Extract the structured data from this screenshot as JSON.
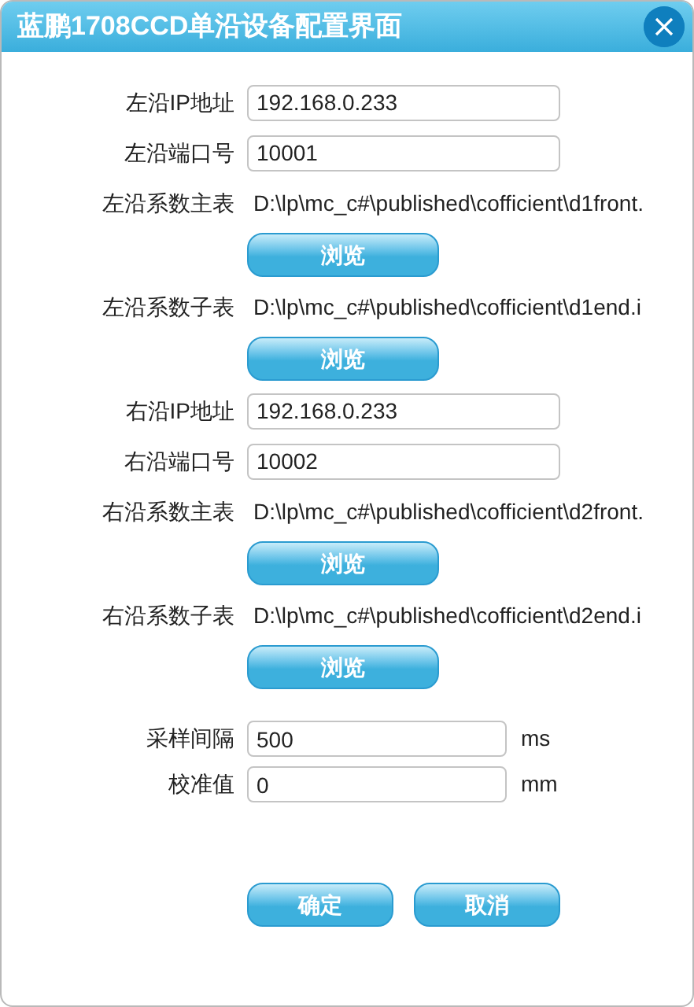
{
  "window": {
    "title": "蓝鹏1708CCD单沿设备配置界面"
  },
  "rows": [
    {
      "kind": "field",
      "label": "左沿IP地址",
      "value": "192.168.0.233"
    },
    {
      "kind": "field",
      "label": "左沿端口号",
      "value": "10001"
    },
    {
      "kind": "path",
      "label": "左沿系数主表",
      "value": "D:\\lp\\mc_c#\\published\\cofficient\\d1front."
    },
    {
      "kind": "button",
      "label": "浏览"
    },
    {
      "kind": "path",
      "label": "左沿系数子表",
      "value": "D:\\lp\\mc_c#\\published\\cofficient\\d1end.i"
    },
    {
      "kind": "button",
      "label": "浏览"
    },
    {
      "kind": "field",
      "label": "右沿IP地址",
      "value": "192.168.0.233"
    },
    {
      "kind": "field",
      "label": "右沿端口号",
      "value": "10002"
    },
    {
      "kind": "path",
      "label": "右沿系数主表",
      "value": "D:\\lp\\mc_c#\\published\\cofficient\\d2front."
    },
    {
      "kind": "button",
      "label": "浏览"
    },
    {
      "kind": "path",
      "label": "右沿系数子表",
      "value": "D:\\lp\\mc_c#\\published\\cofficient\\d2end.i"
    },
    {
      "kind": "button",
      "label": "浏览"
    }
  ],
  "settings": [
    {
      "label": "采样间隔",
      "value": "500",
      "unit": "ms"
    },
    {
      "label": "校准值",
      "value": "0",
      "unit": "mm"
    }
  ],
  "buttons": [
    "确定",
    "取消"
  ]
}
